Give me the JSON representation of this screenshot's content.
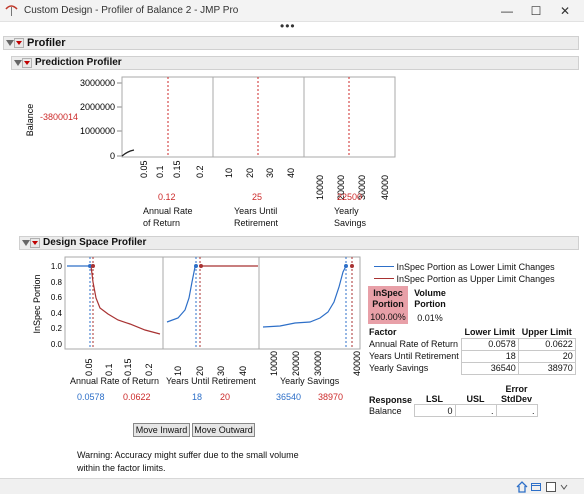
{
  "window": {
    "title": "Custom Design - Profiler of Balance 2 - JMP Pro",
    "minimize": "—",
    "maximize": "☐",
    "close": "✕",
    "menu_dots": "•••"
  },
  "profiler": {
    "title": "Profiler"
  },
  "prediction_profiler": {
    "title": "Prediction Profiler",
    "y_label": "Balance",
    "y_current": "-3800014",
    "y_ticks": [
      "3000000",
      "2000000",
      "1000000",
      "0"
    ],
    "factors": [
      {
        "label": "Annual Rate of Return",
        "label_line1": "Annual Rate",
        "label_line2": "of Return",
        "current": "0.12",
        "ticks": [
          "0.05",
          "0.1",
          "0.15",
          "0.2"
        ]
      },
      {
        "label": "Years Until Retirement",
        "label_line1": "Years Until",
        "label_line2": "Retirement",
        "current": "25",
        "ticks": [
          "10",
          "20",
          "30",
          "40"
        ]
      },
      {
        "label": "Yearly Savings",
        "label_line1": "Yearly",
        "label_line2": "Savings",
        "current": "22500",
        "ticks": [
          "10000",
          "20000",
          "30000",
          "40000"
        ]
      }
    ]
  },
  "design_space_profiler": {
    "title": "Design Space Profiler",
    "y_label": "InSpec Portion",
    "y_ticks": [
      "1.0",
      "0.8",
      "0.6",
      "0.4",
      "0.2",
      "0.0"
    ],
    "legend": [
      {
        "label": "InSpec Portion as Lower Limit Changes",
        "color": "#2d6fc8"
      },
      {
        "label": "InSpec Portion as Upper Limit Changes",
        "color": "#a83232"
      }
    ],
    "panels": [
      {
        "label": "Annual Rate of Return",
        "lower": "0.0578",
        "upper": "0.0622",
        "ticks": [
          "0.05",
          "0.1",
          "0.15",
          "0.2"
        ]
      },
      {
        "label": "Years Until Retirement",
        "lower": "18",
        "upper": "20",
        "ticks": [
          "10",
          "20",
          "30",
          "40"
        ]
      },
      {
        "label": "Yearly Savings",
        "lower": "36540",
        "upper": "38970",
        "ticks": [
          "10000",
          "20000",
          "30000",
          "40000"
        ]
      }
    ],
    "inspec": {
      "header1": "InSpec",
      "header2": "Portion",
      "value": "100.00%"
    },
    "volume": {
      "header1": "Volume",
      "header2": "Portion",
      "value": "0.01%"
    },
    "factor_table": {
      "headers": [
        "Factor",
        "Lower Limit",
        "Upper Limit"
      ],
      "rows": [
        [
          "Annual Rate of Return",
          "0.0578",
          "0.0622"
        ],
        [
          "Years Until Retirement",
          "18",
          "20"
        ],
        [
          "Yearly Savings",
          "36540",
          "38970"
        ]
      ]
    },
    "response_table": {
      "headers": [
        "Response",
        "LSL",
        "USL",
        "Error",
        "StdDev"
      ],
      "rows": [
        [
          "Balance",
          "0",
          ".",
          "."
        ]
      ]
    },
    "buttons": {
      "move_inward": "Move Inward",
      "move_outward": "Move Outward"
    },
    "warning_line1": "Warning: Accuracy might suffer due to the small volume",
    "warning_line2": "within the factor limits."
  }
}
